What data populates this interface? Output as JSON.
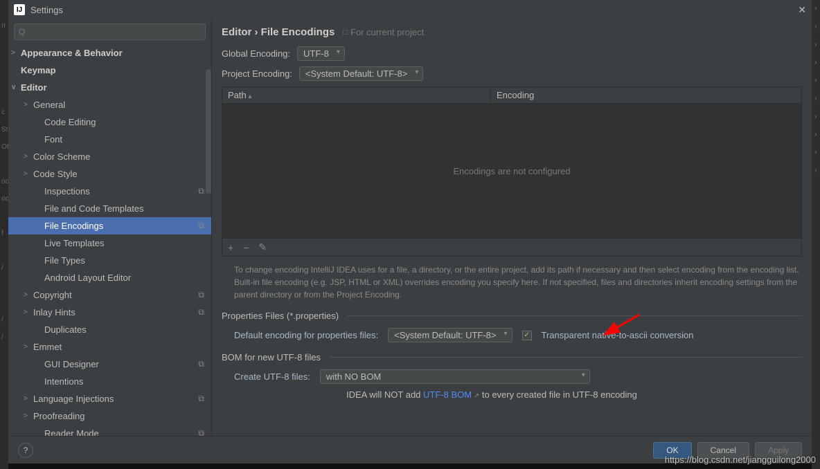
{
  "window": {
    "title": "Settings",
    "close": "✕"
  },
  "search": {
    "placeholder": "Q"
  },
  "tree": [
    {
      "label": "Appearance & Behavior",
      "level": "l0",
      "bold": true,
      "chev": ">"
    },
    {
      "label": "Keymap",
      "level": "l0",
      "bold": true
    },
    {
      "label": "Editor",
      "level": "l0",
      "bold": true,
      "chev": "∨"
    },
    {
      "label": "General",
      "level": "l1",
      "chev": ">"
    },
    {
      "label": "Code Editing",
      "level": "l2"
    },
    {
      "label": "Font",
      "level": "l2"
    },
    {
      "label": "Color Scheme",
      "level": "l1",
      "chev": ">"
    },
    {
      "label": "Code Style",
      "level": "l1",
      "chev": ">"
    },
    {
      "label": "Inspections",
      "level": "l2",
      "tag": "⧉"
    },
    {
      "label": "File and Code Templates",
      "level": "l2"
    },
    {
      "label": "File Encodings",
      "level": "l2",
      "tag": "⧉",
      "selected": true
    },
    {
      "label": "Live Templates",
      "level": "l2"
    },
    {
      "label": "File Types",
      "level": "l2"
    },
    {
      "label": "Android Layout Editor",
      "level": "l2"
    },
    {
      "label": "Copyright",
      "level": "l1",
      "chev": ">",
      "tag": "⧉"
    },
    {
      "label": "Inlay Hints",
      "level": "l1",
      "chev": ">",
      "tag": "⧉"
    },
    {
      "label": "Duplicates",
      "level": "l2"
    },
    {
      "label": "Emmet",
      "level": "l1",
      "chev": ">"
    },
    {
      "label": "GUI Designer",
      "level": "l2",
      "tag": "⧉"
    },
    {
      "label": "Intentions",
      "level": "l2"
    },
    {
      "label": "Language Injections",
      "level": "l1",
      "chev": ">",
      "tag": "⧉"
    },
    {
      "label": "Proofreading",
      "level": "l1",
      "chev": ">"
    },
    {
      "label": "Reader Mode",
      "level": "l2",
      "tag": "⧉"
    }
  ],
  "crumb": {
    "path": "Editor › File Encodings",
    "scope": "For current project"
  },
  "global": {
    "label": "Global Encoding:",
    "value": "UTF-8"
  },
  "project": {
    "label": "Project Encoding:",
    "value": "<System Default: UTF-8>"
  },
  "table": {
    "col_path": "Path",
    "col_enc": "Encoding",
    "empty": "Encodings are not configured"
  },
  "toolbar": {
    "add": "+",
    "remove": "−",
    "edit": "✎"
  },
  "hint": "To change encoding IntelliJ IDEA uses for a file, a directory, or the entire project, add its path if necessary and then select encoding from the encoding list. Built-in file encoding (e.g. JSP, HTML or XML) overrides encoding you specify here. If not specified, files and directories inherit encoding settings from the parent directory or from the Project Encoding.",
  "props": {
    "legend": "Properties Files (*.properties)",
    "label": "Default encoding for properties files:",
    "value": "<System Default: UTF-8>",
    "chk_label": "Transparent native-to-ascii conversion",
    "chk_on": true
  },
  "bom": {
    "legend": "BOM for new UTF-8 files",
    "label": "Create UTF-8 files:",
    "value": "with NO BOM",
    "note_pre": "IDEA will NOT add ",
    "note_link": "UTF-8 BOM",
    "note_post": " to every created file in UTF-8 encoding"
  },
  "footer": {
    "help": "?",
    "ok": "OK",
    "cancel": "Cancel",
    "apply": "Apply"
  },
  "watermark": "https://blog.csdn.net/jiangguilong2000"
}
